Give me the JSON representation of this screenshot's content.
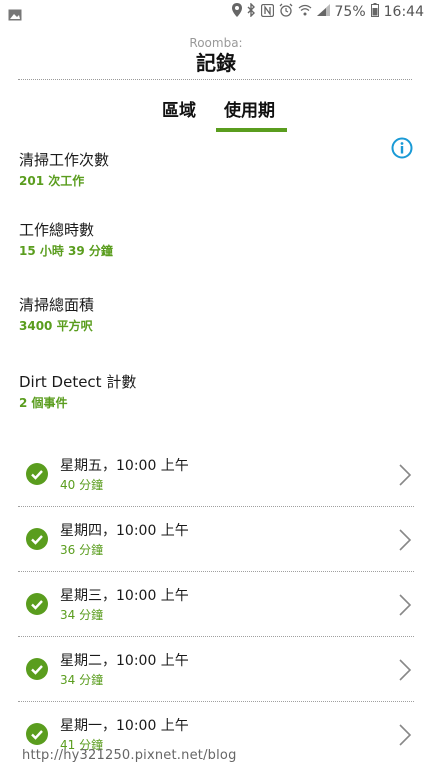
{
  "status_bar": {
    "battery": "75%",
    "time": "16:44"
  },
  "header": {
    "subtitle": "Roomba:",
    "title": "記錄"
  },
  "tabs": [
    {
      "label": "區域",
      "active": false
    },
    {
      "label": "使用期",
      "active": true
    }
  ],
  "stats": [
    {
      "label": "清掃工作次數",
      "value": "201 次工作"
    },
    {
      "label": "工作總時數",
      "value": "15 小時 39 分鐘"
    },
    {
      "label": "清掃總面積",
      "value": "3400 平方呎"
    },
    {
      "label": "Dirt Detect 計數",
      "value": "2 個事件"
    }
  ],
  "runs": [
    {
      "title": "星期五，10:00 上午",
      "duration": "40 分鐘"
    },
    {
      "title": "星期四，10:00 上午",
      "duration": "36 分鐘"
    },
    {
      "title": "星期三，10:00 上午",
      "duration": "34 分鐘"
    },
    {
      "title": "星期二，10:00 上午",
      "duration": "34 分鐘"
    },
    {
      "title": "星期一，10:00 上午",
      "duration": "41 分鐘"
    }
  ],
  "watermark": "http://hy321250.pixnet.net/blog",
  "colors": {
    "accent": "#5a9d1e",
    "info": "#1a9ad6"
  }
}
